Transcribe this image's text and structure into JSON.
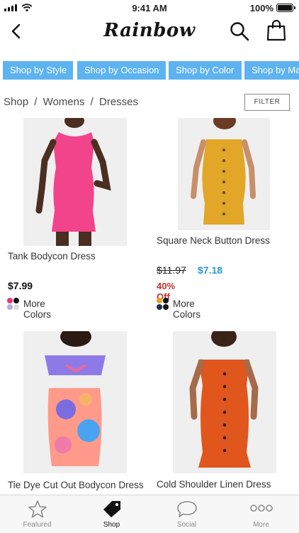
{
  "status_bar": {
    "time": "9:41 AM",
    "battery": "100%"
  },
  "header": {
    "brand": "Rainbow"
  },
  "tabs": [
    "Shop by Style",
    "Shop by Occasion",
    "Shop by Color",
    "Shop by Ma"
  ],
  "breadcrumb": {
    "shop": "Shop",
    "sep1": "/",
    "womens": "Womens",
    "sep2": "/",
    "dresses": "Dresses"
  },
  "filter_label": "FILTER",
  "products": [
    {
      "name": "Tank Bodycon Dress",
      "price": "$7.99",
      "more_colors": "More Colors",
      "swatches": [
        "#e8357c",
        "#111111",
        "#b9a9d6",
        "#dcdcdc"
      ],
      "dress_color": "#f2448a"
    },
    {
      "name": "Square Neck Button Dress",
      "original_price": "$11.97",
      "sale_price": "$7.18",
      "discount": "40% Off",
      "more_colors": "More Colors",
      "swatches": [
        "#e2a72a",
        "#111111",
        "#1e2d4f",
        "#111111"
      ],
      "dress_color": "#e2a728"
    },
    {
      "name": "Tie Dye Cut Out Bodycon Dress",
      "dress_color": "#ff9a8a"
    },
    {
      "name": "Cold Shoulder Linen Dress",
      "dress_color": "#e0561c"
    }
  ],
  "tabbar": [
    {
      "label": "Featured",
      "icon": "star-icon",
      "active": false
    },
    {
      "label": "Shop",
      "icon": "tag-icon",
      "active": true
    },
    {
      "label": "Social",
      "icon": "chat-bubble-icon",
      "active": false
    },
    {
      "label": "More",
      "icon": "more-dots-icon",
      "active": false
    }
  ]
}
